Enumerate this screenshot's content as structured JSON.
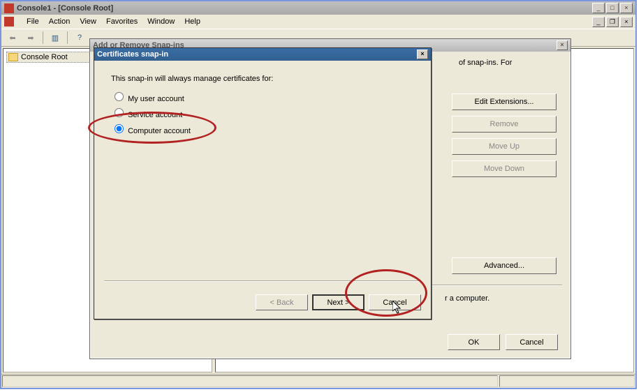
{
  "mmc": {
    "title": "Console1 - [Console Root]",
    "menu": {
      "file": "File",
      "action": "Action",
      "view": "View",
      "favorites": "Favorites",
      "window": "Window",
      "help": "Help"
    },
    "tree": {
      "root": "Console Root"
    }
  },
  "addremove": {
    "title": "Add or Remove Snap-ins",
    "info_fragment": "of snap-ins. For",
    "buttons": {
      "edit_ext": "Edit Extensions...",
      "remove": "Remove",
      "move_up": "Move Up",
      "move_down": "Move Down",
      "advanced": "Advanced..."
    },
    "desc_fragment": "r a computer.",
    "ok": "OK",
    "cancel": "Cancel"
  },
  "certdlg": {
    "title": "Certificates snap-in",
    "prompt": "This snap-in will always manage certificates for:",
    "options": {
      "my_user": "My user account",
      "service": "Service account",
      "computer": "Computer account"
    },
    "selected": "computer",
    "buttons": {
      "back": "< Back",
      "next": "Next >",
      "cancel": "Cancel"
    }
  },
  "winbtn": {
    "min": "0",
    "max": "1",
    "restore": "2",
    "close": "r"
  }
}
